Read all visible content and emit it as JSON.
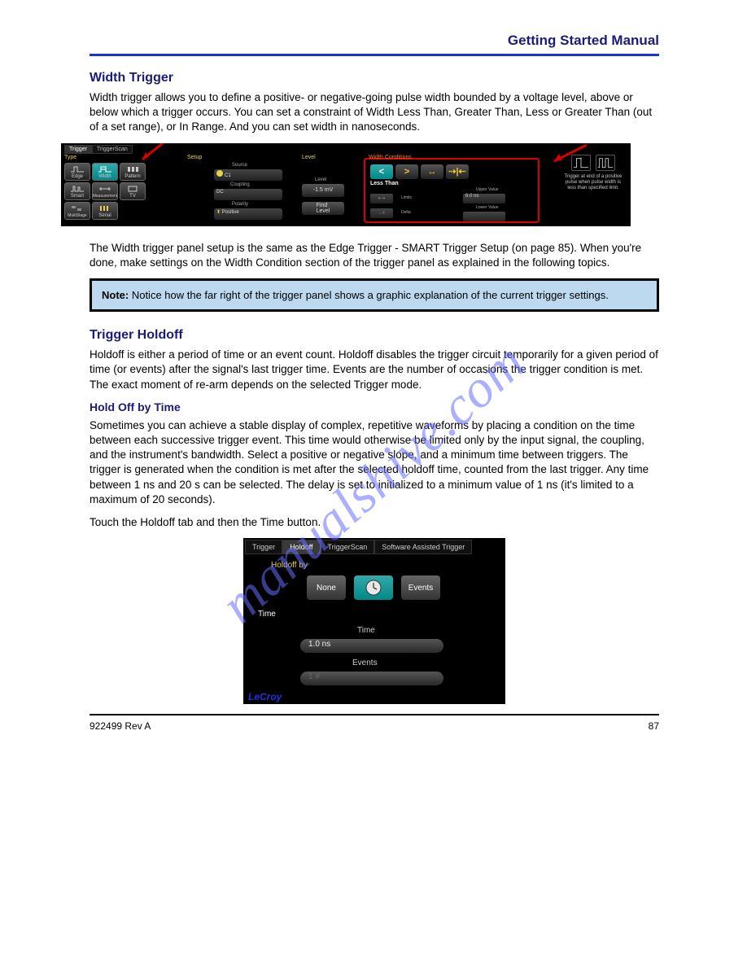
{
  "header": {
    "title": "Getting Started Manual"
  },
  "sections": {
    "width_title": "Width Trigger",
    "width_para": "Width trigger allows you to define a positive- or negative-going pulse width bounded by a voltage level, above or below which a trigger occurs. You can set a constraint of Width Less Than, Greater Than, Less or Greater Than (out of a set range), or In Range. And you can set width in nanoseconds.",
    "width_setup": "The Width trigger panel setup is the same as the Edge Trigger - SMART Trigger Setup (on page 85). When you're done, make settings on the Width Condition section of the trigger panel as explained in the following topics.",
    "note": {
      "label": "Note:",
      "text": " Notice how the far right of the trigger panel shows a graphic explanation of the current trigger settings."
    },
    "holdoff_title": "Trigger Holdoff",
    "holdoff_para": "Holdoff is either a period of time or an event count. Holdoff disables the trigger circuit temporarily for a given period of time (or events) after the signal's last trigger time. Events are the number of occasions the trigger condition is met. The exact moment of re-arm depends on the selected Trigger mode.",
    "holdoff_time_title": "Hold Off by Time",
    "holdoff_time_para": "Sometimes you can achieve a stable display of complex, repetitive waveforms by placing a condition on the time between each successive trigger event. This time would otherwise be limited only by the input signal, the coupling, and the instrument's bandwidth. Select a positive or negative slope, and a minimum time between triggers. The trigger is generated when the condition is met after the selected holdoff time, counted from the last trigger. Any time between 1 ns and 20 s can be selected. The delay is set to initialized to a minimum value of 1 ns (it's limited to a maximum of 20 seconds).",
    "holdoff_time_touch": "Touch the Holdoff tab and then the Time button."
  },
  "fig1": {
    "tabs": {
      "trigger": "Trigger",
      "scan": "TriggerScan"
    },
    "type": {
      "label": "Type",
      "edge": "Edge",
      "width": "Width",
      "pattern": "Pattern",
      "smart": "Smart",
      "measurement": "Measurement",
      "tv": "TV",
      "multistage": "MultiStage",
      "serial": "Serial"
    },
    "setup": {
      "label": "Setup",
      "source": "Source",
      "source_val": "C1",
      "coupling": "Coupling",
      "coupling_val": "DC",
      "polarity": "Polarity",
      "polarity_val": "Positive"
    },
    "level": {
      "label": "Level",
      "level_head": "Level",
      "level_val": "-1.5 mV",
      "find": "Find\nLevel"
    },
    "wc": {
      "label": "Width Conditions",
      "lt": "<",
      "gt": ">",
      "arr1": "↔",
      "arr2": "⇢|⇠",
      "less_than": "Less Than",
      "limits": "Limits",
      "delta": "Delta",
      "upper": "Upper Value",
      "upper_val": "6.0 ns",
      "lower": "Lower Value"
    },
    "right": {
      "desc": "Trigger at end of a positive pulse when pulse width is less than specified limit."
    }
  },
  "fig2": {
    "tabs": {
      "trigger": "Trigger",
      "holdoff": "Holdoff",
      "scan": "TriggerScan",
      "sat": "Software Assisted Trigger"
    },
    "holdoff_by": "Holdoff by",
    "none": "None",
    "events": "Events",
    "time_lbl": "Time",
    "time_head": "Time",
    "time_val": "1.0 ns",
    "events_head": "Events",
    "events_val": "1 #",
    "brand": "LeCroy"
  },
  "footer": {
    "left": "922499 Rev A",
    "right": "87"
  },
  "watermark": "manualshive.com"
}
